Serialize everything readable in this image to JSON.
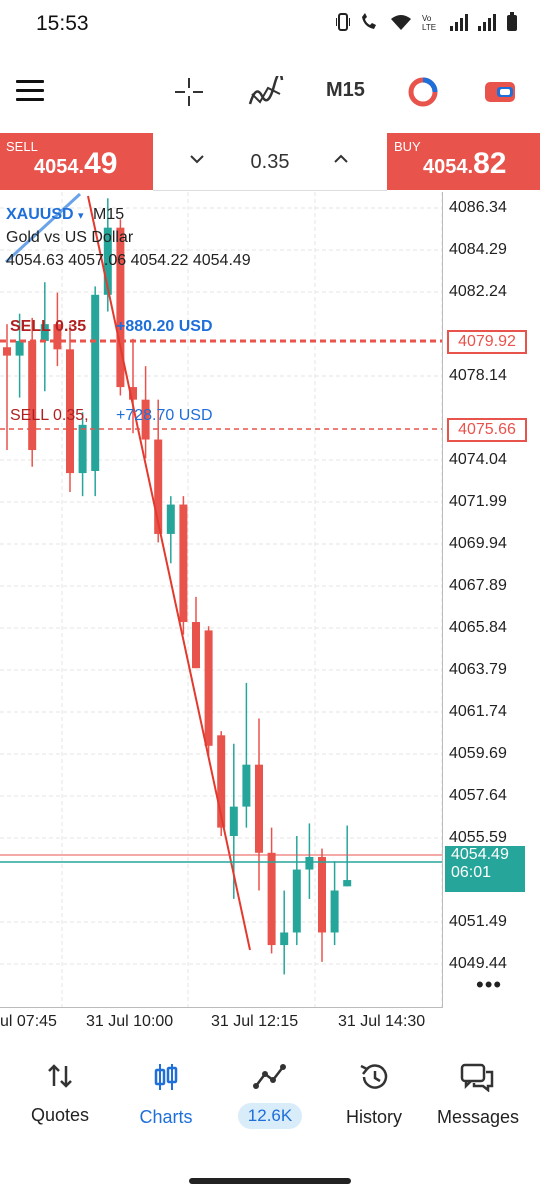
{
  "status": {
    "time": "15:53"
  },
  "toolbar": {
    "timeframe": "M15"
  },
  "trade": {
    "sell_label": "SELL",
    "sell_price_main": "4054.",
    "sell_price_big": "49",
    "buy_label": "BUY",
    "buy_price_main": "4054.",
    "buy_price_big": "82",
    "lot": "0.35"
  },
  "chart": {
    "symbol": "XAUUSD",
    "timeframe": "M15",
    "description": "Gold vs US Dollar",
    "ohlc": "4054.63 4057.06 4054.22 4054.49",
    "position1_label": "SELL 0.35",
    "position1_profit": "+880.20 USD",
    "position2_label": "SELL 0.35,",
    "position2_profit": "+728.70 USD",
    "order_price_1": "4079.92",
    "order_price_2": "4075.66",
    "current_price": "4054.49",
    "countdown": "06:01",
    "price_axis": [
      "4086.34",
      "4084.29",
      "4082.24",
      "4079.92",
      "4078.14",
      "4075.66",
      "4074.04",
      "4071.99",
      "4069.94",
      "4067.89",
      "4065.84",
      "4063.79",
      "4061.74",
      "4059.69",
      "4057.64",
      "4055.59",
      "4054.49",
      "4051.49",
      "4049.44"
    ],
    "time_axis": [
      "ul 07:45",
      "31 Jul 10:00",
      "31 Jul 12:15",
      "31 Jul 14:30"
    ]
  },
  "chart_data": {
    "type": "candlestick",
    "symbol": "XAUUSD",
    "timeframe": "M15",
    "ylim": [
      4048.4,
      4087.3
    ],
    "candles": [
      {
        "o": 4079.9,
        "h": 4081.0,
        "l": 4075.0,
        "c": 4079.5
      },
      {
        "o": 4079.5,
        "h": 4081.5,
        "l": 4077.5,
        "c": 4080.2
      },
      {
        "o": 4080.2,
        "h": 4081.3,
        "l": 4074.2,
        "c": 4075.0
      },
      {
        "o": 4080.2,
        "h": 4083.0,
        "l": 4077.8,
        "c": 4081.0
      },
      {
        "o": 4081.0,
        "h": 4082.5,
        "l": 4079.0,
        "c": 4079.8
      },
      {
        "o": 4079.8,
        "h": 4081.0,
        "l": 4073.0,
        "c": 4073.9
      },
      {
        "o": 4073.9,
        "h": 4076.8,
        "l": 4072.8,
        "c": 4076.2
      },
      {
        "o": 4074.0,
        "h": 4082.8,
        "l": 4072.8,
        "c": 4082.4
      },
      {
        "o": 4082.4,
        "h": 4087.0,
        "l": 4081.6,
        "c": 4085.6
      },
      {
        "o": 4085.6,
        "h": 4086.0,
        "l": 4077.6,
        "c": 4078.0
      },
      {
        "o": 4078.0,
        "h": 4080.3,
        "l": 4075.8,
        "c": 4077.4
      },
      {
        "o": 4077.4,
        "h": 4079.0,
        "l": 4074.6,
        "c": 4075.5
      },
      {
        "o": 4075.5,
        "h": 4077.4,
        "l": 4070.6,
        "c": 4071.0
      },
      {
        "o": 4071.0,
        "h": 4072.8,
        "l": 4069.6,
        "c": 4072.4
      },
      {
        "o": 4072.4,
        "h": 4072.8,
        "l": 4066.2,
        "c": 4066.8
      },
      {
        "o": 4066.8,
        "h": 4068.0,
        "l": 4064.6,
        "c": 4064.6
      },
      {
        "o": 4066.4,
        "h": 4066.6,
        "l": 4060.4,
        "c": 4060.9
      },
      {
        "o": 4061.4,
        "h": 4061.6,
        "l": 4056.6,
        "c": 4057.0
      },
      {
        "o": 4056.6,
        "h": 4061.0,
        "l": 4053.6,
        "c": 4058.0
      },
      {
        "o": 4058.0,
        "h": 4063.9,
        "l": 4057.0,
        "c": 4060.0
      },
      {
        "o": 4060.0,
        "h": 4062.2,
        "l": 4054.0,
        "c": 4055.8
      },
      {
        "o": 4055.8,
        "h": 4057.0,
        "l": 4051.0,
        "c": 4051.4
      },
      {
        "o": 4051.4,
        "h": 4054.0,
        "l": 4050.0,
        "c": 4052.0
      },
      {
        "o": 4052.0,
        "h": 4056.6,
        "l": 4051.4,
        "c": 4055.0
      },
      {
        "o": 4055.0,
        "h": 4057.2,
        "l": 4053.6,
        "c": 4055.6
      },
      {
        "o": 4055.6,
        "h": 4056.0,
        "l": 4050.6,
        "c": 4052.0
      },
      {
        "o": 4052.0,
        "h": 4055.4,
        "l": 4051.4,
        "c": 4054.0
      },
      {
        "o": 4054.2,
        "h": 4057.1,
        "l": 4054.2,
        "c": 4054.5
      }
    ]
  },
  "nav": [
    {
      "label": "Quotes"
    },
    {
      "label": "Charts"
    },
    {
      "label": "12.6K"
    },
    {
      "label": "History"
    },
    {
      "label": "Messages"
    }
  ],
  "colors": {
    "sell_red": "#e8534c",
    "up_green": "#26a69a",
    "accent_blue": "#1e6fd9"
  }
}
